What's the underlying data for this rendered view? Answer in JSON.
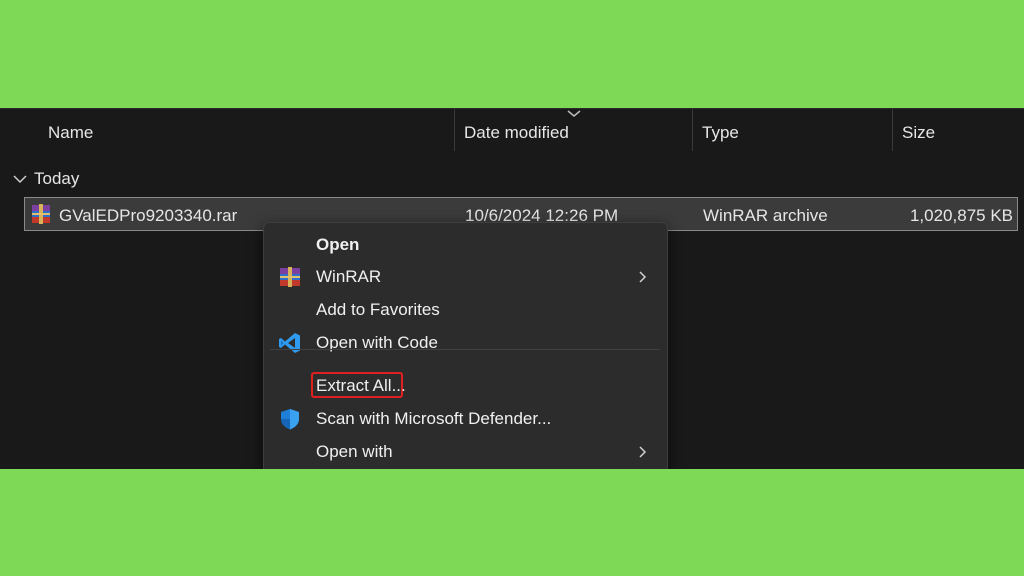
{
  "columns": {
    "name": "Name",
    "date_modified": "Date modified",
    "type": "Type",
    "size": "Size"
  },
  "group": {
    "label": "Today"
  },
  "file": {
    "name": "GValEDPro9203340.rar",
    "date_modified": "10/6/2024 12:26 PM",
    "type": "WinRAR archive",
    "size": "1,020,875 KB"
  },
  "context_menu": {
    "open": "Open",
    "winrar": "WinRAR",
    "add_to_favorites": "Add to Favorites",
    "open_with_code": "Open with Code",
    "extract_all": "Extract All...",
    "scan_defender": "Scan with Microsoft Defender...",
    "open_with": "Open with"
  },
  "colors": {
    "background": "#7ed957",
    "explorer_bg": "#191919",
    "menu_bg": "#2c2c2c",
    "highlight_border": "#e02020",
    "vscode_blue": "#2f9bf0",
    "defender_blue": "#1f7fd8"
  },
  "icons": {
    "file": "winrar-archive-icon",
    "winrar": "winrar-icon",
    "code": "vscode-icon",
    "defender": "defender-shield-icon"
  }
}
